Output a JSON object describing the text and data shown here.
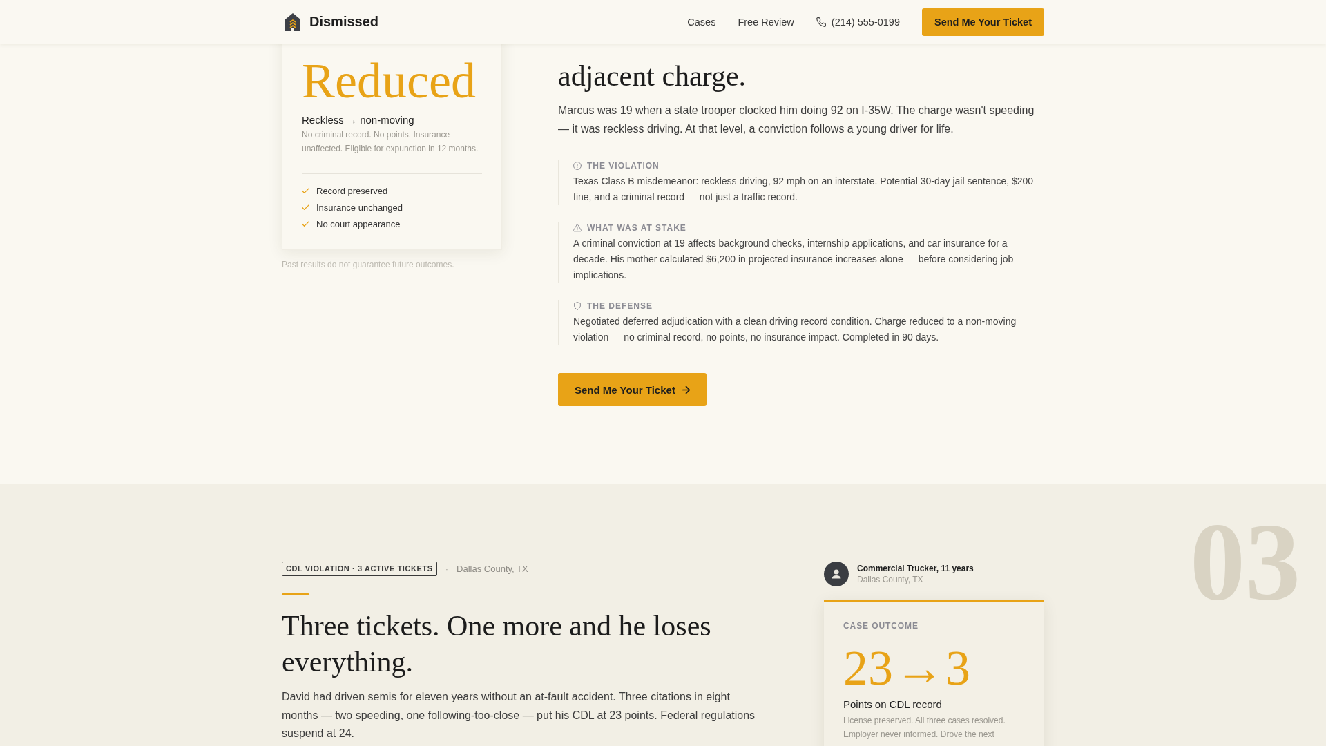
{
  "header": {
    "brand": "Dismissed",
    "nav": [
      "Cases",
      "Free Review"
    ],
    "phone": "(214) 555-0199",
    "cta": "Send Me Your Ticket"
  },
  "featured_case": {
    "outcome_card": {
      "result": "Reduced",
      "change": "Reckless → non-moving",
      "description": "No criminal record. No points. Insurance unaffected. Eligible for expunction in 12 months.",
      "benefits": [
        "Record preserved",
        "Insurance unchanged",
        "No court appearance"
      ]
    },
    "disclaimer": "Past results do not guarantee future outcomes.",
    "heading": "adjacent charge.",
    "intro": "Marcus was 19 when a state trooper clocked him doing 92 on I-35W. The charge wasn't speeding — it was reckless driving. At that level, a conviction follows a young driver for life.",
    "details": [
      {
        "label": "THE VIOLATION",
        "text": "Texas Class B misdemeanor: reckless driving, 92 mph on an interstate. Potential 30-day jail sentence, $200 fine, and a criminal record — not just a traffic record."
      },
      {
        "label": "WHAT WAS AT STAKE",
        "text": "A criminal conviction at 19 affects background checks, internship applications, and car insurance for a decade. His mother calculated $6,200 in projected insurance increases alone — before considering job implications."
      },
      {
        "label": "THE DEFENSE",
        "text": "Negotiated deferred adjudication with a clean driving record condition. Charge reduced to a non-moving violation — no criminal record, no points, no insurance impact. Completed in 90 days."
      }
    ],
    "cta": "Send Me Your Ticket"
  },
  "next_case": {
    "section_number": "03",
    "tag": "CDL VIOLATION · 3 ACTIVE TICKETS",
    "separator": "·",
    "location": "Dallas County, TX",
    "heading": "Three tickets. One more and he loses everything.",
    "intro": "David had driven semis for eleven years without an at-fault accident. Three citations in eight months — two speeding, one following-too-close — put his CDL at 23 points. Federal regulations suspend at 24.",
    "client": {
      "title": "Commercial Trucker, 11 years",
      "location": "Dallas County, TX"
    },
    "outcome_card": {
      "label": "CASE OUTCOME",
      "result": "23 → 3",
      "caption": "Points on CDL record",
      "description": "License preserved. All three cases resolved. Employer never informed. Drove the next"
    }
  }
}
